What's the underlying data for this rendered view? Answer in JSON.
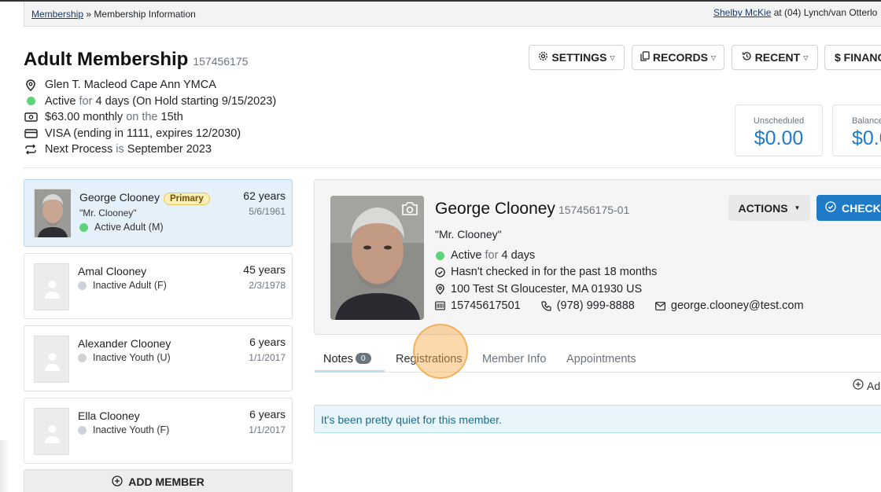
{
  "breadcrumb": {
    "root": "Membership",
    "separator": "»",
    "current": "Membership Information"
  },
  "user": {
    "name": "Shelby McKie",
    "location": "at (04) Lynch/van Otterlo"
  },
  "membership": {
    "title": "Adult Membership",
    "number": "157456175",
    "branch": "Glen T. Macleod Cape Ann YMCA",
    "status": {
      "label": "Active",
      "for": "for",
      "duration": "4 days (On Hold starting 9/15/2023)"
    },
    "billing": {
      "amount": "$63.00 monthly",
      "on": "on the",
      "day": "15th"
    },
    "payment": "VISA (ending in 1111, expires 12/2030)",
    "next_process": {
      "label": "Next Process",
      "is": "is",
      "date": "September 2023"
    }
  },
  "toolbar": {
    "settings": "SETTINGS",
    "records": "RECORDS",
    "recent": "RECENT",
    "finance": "$ FINANC"
  },
  "balances": [
    {
      "label": "Unscheduled",
      "value": "$0.00"
    },
    {
      "label": "Balance",
      "value": "$0.0"
    }
  ],
  "members": [
    {
      "name": "George Clooney",
      "badge": "Primary",
      "nickname": "\"Mr. Clooney\"",
      "status": "Active Adult (M)",
      "age": "62 years",
      "dob": "5/6/1961",
      "active": true
    },
    {
      "name": "Amal Clooney",
      "status": "Inactive Adult (F)",
      "age": "45 years",
      "dob": "2/3/1978",
      "active": false
    },
    {
      "name": "Alexander Clooney",
      "status": "Inactive Youth (U)",
      "age": "6 years",
      "dob": "1/1/2017",
      "active": false
    },
    {
      "name": "Ella Clooney",
      "status": "Inactive Youth (F)",
      "age": "6 years",
      "dob": "1/1/2017",
      "active": false
    }
  ],
  "add_member": "ADD MEMBER",
  "detail": {
    "name": "George Clooney",
    "number": "157456175-01",
    "nickname": "\"Mr. Clooney\"",
    "status": {
      "label": "Active",
      "for": "for",
      "duration": "4 days"
    },
    "checkin": "Hasn't checked in for the past 18 months",
    "address": "100 Test St Gloucester, MA 01930 US",
    "barcode": "15745617501",
    "phone": "(978) 999-8888",
    "email": "george.clooney@test.com",
    "actions": "ACTIONS",
    "check_button": "CHECK"
  },
  "tabs": {
    "notes": "Notes",
    "notes_count": "0",
    "registrations": "Registrations",
    "member_info": "Member Info",
    "appointments": "Appointments"
  },
  "add_note": "Ad",
  "empty_message": "It's been pretty quiet for this member."
}
